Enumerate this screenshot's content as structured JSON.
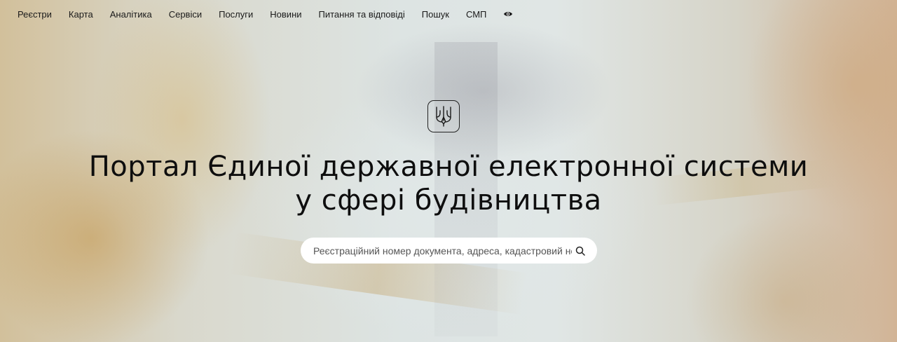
{
  "nav": {
    "items": [
      {
        "label": "Реєстри"
      },
      {
        "label": "Карта"
      },
      {
        "label": "Аналітика"
      },
      {
        "label": "Сервіси"
      },
      {
        "label": "Послуги"
      },
      {
        "label": "Новини"
      },
      {
        "label": "Питання та відповіді"
      },
      {
        "label": "Пошук"
      },
      {
        "label": "СМП"
      }
    ],
    "accessibility_icon": "eye-icon"
  },
  "emblem": {
    "icon": "trident-icon"
  },
  "hero": {
    "title_line1": "Портал Єдиної державної електронної системи",
    "title_line2": "у сфері будівництва"
  },
  "search": {
    "placeholder": "Реєстраційний номер документа, адреса, кадастровий номер",
    "value": "",
    "icon": "search-icon"
  },
  "colors": {
    "text": "#111111",
    "search_bg": "#ffffff"
  }
}
